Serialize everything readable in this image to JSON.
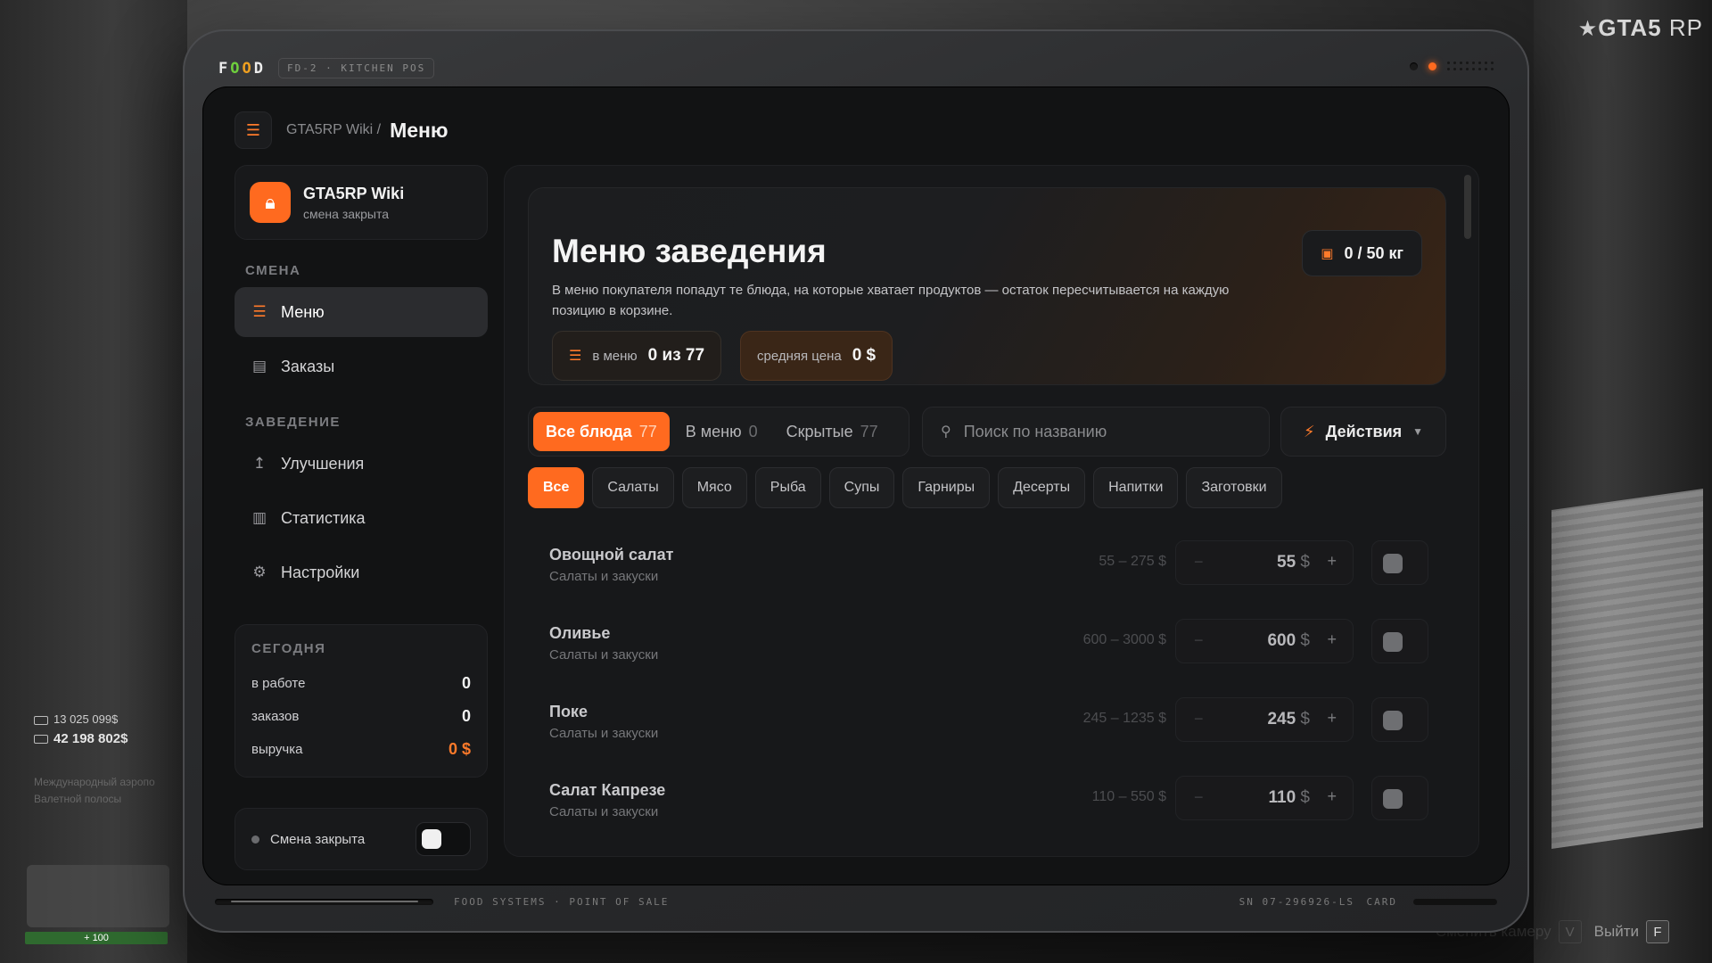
{
  "game": {
    "logo_main": "GTA5",
    "logo_sub": "RP"
  },
  "hud": {
    "money_bank": "13 025 099$",
    "money_cash": "42 198 802$",
    "faded_line_1": "Международный аэропо",
    "faded_line_2": "Валетной полосы",
    "health": "100"
  },
  "hints": {
    "camera_label": "Сменить камеру",
    "camera_key": "V",
    "exit_label": "Выйти",
    "exit_key": "F"
  },
  "device": {
    "brand": "FOOD",
    "model": "FD-2 · KITCHEN POS",
    "footer_left": "FOOD SYSTEMS · POINT OF SALE",
    "serial": "SN 07-296926-LS",
    "card": "CARD"
  },
  "breadcrumb": {
    "root": "GTA5RP Wiki /",
    "current": "Меню"
  },
  "venue": {
    "name": "GTA5RP Wiki",
    "status": "смена закрыта"
  },
  "sidebar": {
    "section_shift": "СМЕНА",
    "section_venue": "ЗАВЕДЕНИЕ",
    "items": [
      {
        "label": "Меню",
        "icon": "list-icon",
        "active": true
      },
      {
        "label": "Заказы",
        "icon": "receipt-icon",
        "active": false
      },
      {
        "label": "Улучшения",
        "icon": "arrow-up-icon",
        "active": false
      },
      {
        "label": "Статистика",
        "icon": "bar-chart-icon",
        "active": false
      },
      {
        "label": "Настройки",
        "icon": "gear-icon",
        "active": false
      }
    ]
  },
  "today": {
    "title": "СЕГОДНЯ",
    "in_work_label": "в работе",
    "in_work_value": "0",
    "orders_label": "заказов",
    "orders_value": "0",
    "revenue_label": "выручка",
    "revenue_value": "0 $"
  },
  "shift": {
    "label": "Смена закрыта",
    "toggle_on": false
  },
  "hero": {
    "title": "Меню заведения",
    "description": "В меню покупателя попадут те блюда, на которые хватает продуктов — остаток пересчитывается на каждую позицию в корзине.",
    "weight": "0 / 50 кг",
    "in_menu_label": "в меню",
    "in_menu_value": "0 из 77",
    "avg_price_label": "средняя цена",
    "avg_price_value": "0 $"
  },
  "view_tabs": [
    {
      "label": "Все блюда",
      "count": "77",
      "active": true
    },
    {
      "label": "В меню",
      "count": "0",
      "active": false
    },
    {
      "label": "Скрытые",
      "count": "77",
      "active": false
    }
  ],
  "search": {
    "placeholder": "Поиск по названию",
    "value": ""
  },
  "actions": {
    "label": "Действия"
  },
  "categories": [
    {
      "label": "Все",
      "active": true
    },
    {
      "label": "Салаты",
      "active": false
    },
    {
      "label": "Мясо",
      "active": false
    },
    {
      "label": "Рыба",
      "active": false
    },
    {
      "label": "Супы",
      "active": false
    },
    {
      "label": "Гарниры",
      "active": false
    },
    {
      "label": "Десерты",
      "active": false
    },
    {
      "label": "Напитки",
      "active": false
    },
    {
      "label": "Заготовки",
      "active": false
    }
  ],
  "dishes": [
    {
      "name": "Овощной салат",
      "category": "Салаты и закуски",
      "range": "55 – 275 $",
      "price": "55",
      "currency": "$"
    },
    {
      "name": "Оливье",
      "category": "Салаты и закуски",
      "range": "600 – 3000 $",
      "price": "600",
      "currency": "$"
    },
    {
      "name": "Поке",
      "category": "Салаты и закуски",
      "range": "245 – 1235 $",
      "price": "245",
      "currency": "$"
    },
    {
      "name": "Салат Капрезе",
      "category": "Салаты и закуски",
      "range": "110 – 550 $",
      "price": "110",
      "currency": "$"
    }
  ],
  "colors": {
    "accent": "#ff6a1f",
    "background": "#121314",
    "panel": "#17181a"
  }
}
